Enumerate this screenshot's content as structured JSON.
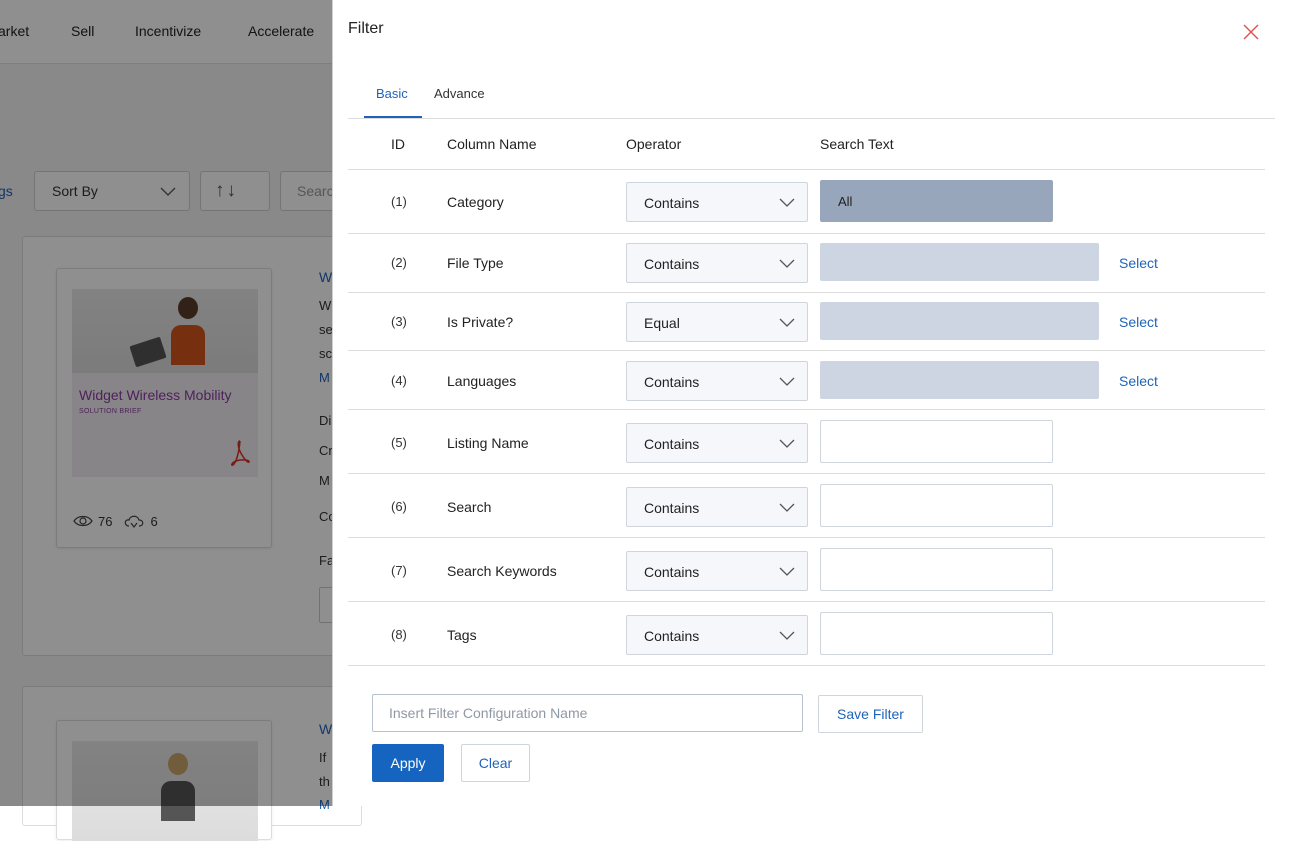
{
  "background": {
    "nav": [
      "arket",
      "Sell",
      "Incentivize",
      "Accelerate"
    ],
    "toolbar": {
      "tags_label": "gs",
      "sort_label": "Sort By",
      "sort_dir_label": "↑↓",
      "search_placeholder": "Searc"
    },
    "cards": [
      {
        "thumb_title": "Widget Wireless Mobility",
        "thumb_subtitle": "SOLUTION BRIEF",
        "views": "76",
        "downloads": "6",
        "title_frag": "W",
        "desc_frags": [
          "W",
          "se",
          "sc"
        ],
        "link_frag": "M",
        "meta_frags": [
          "Di",
          "Cr",
          "M",
          "Co",
          "Fa"
        ]
      },
      {
        "title_frag": "W",
        "desc_frags": [
          "If",
          "th"
        ],
        "link_frag": "M"
      }
    ]
  },
  "panel": {
    "title": "Filter",
    "tabs": [
      {
        "label": "Basic",
        "active": true
      },
      {
        "label": "Advance",
        "active": false
      }
    ],
    "headers": {
      "id": "ID",
      "column": "Column Name",
      "operator": "Operator",
      "search": "Search Text"
    },
    "rows": [
      {
        "id": "(1)",
        "column": "Category",
        "operator": "Contains",
        "value": "All",
        "search_type": "filled"
      },
      {
        "id": "(2)",
        "column": "File Type",
        "operator": "Contains",
        "value": "",
        "search_type": "select",
        "link": "Select"
      },
      {
        "id": "(3)",
        "column": "Is Private?",
        "operator": "Equal",
        "value": "",
        "search_type": "select",
        "link": "Select"
      },
      {
        "id": "(4)",
        "column": "Languages",
        "operator": "Contains",
        "value": "",
        "search_type": "select",
        "link": "Select"
      },
      {
        "id": "(5)",
        "column": "Listing Name",
        "operator": "Contains",
        "value": "",
        "search_type": "text"
      },
      {
        "id": "(6)",
        "column": "Search",
        "operator": "Contains",
        "value": "",
        "search_type": "text"
      },
      {
        "id": "(7)",
        "column": "Search Keywords",
        "operator": "Contains",
        "value": "",
        "search_type": "text"
      },
      {
        "id": "(8)",
        "column": "Tags",
        "operator": "Contains",
        "value": "",
        "search_type": "text"
      }
    ],
    "config_placeholder": "Insert Filter Configuration Name",
    "save_label": "Save Filter",
    "apply_label": "Apply",
    "clear_label": "Clear"
  },
  "colors": {
    "accent": "#1f63b8",
    "primary_button": "#1565c0",
    "filled_value": "#98a6bc",
    "select_value": "#ccd5e1",
    "close_icon": "#e05050",
    "thumb_title": "#8d3ba3",
    "overlay": "rgba(0,0,0,0.44)"
  },
  "icons": {
    "close": "close-icon",
    "chevron": "chevron-down-icon",
    "views": "eye-icon",
    "downloads": "cloud-download-icon",
    "file": "pdf-icon"
  }
}
